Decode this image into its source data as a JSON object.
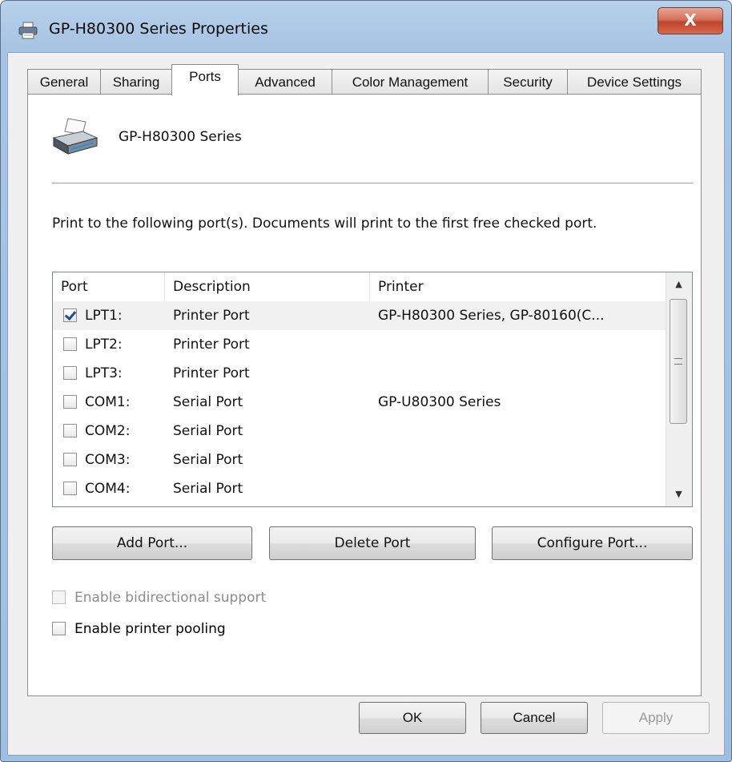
{
  "window": {
    "title": "GP-H80300 Series Properties",
    "close_label": "X"
  },
  "tabs": [
    {
      "label": "General"
    },
    {
      "label": "Sharing"
    },
    {
      "label": "Ports"
    },
    {
      "label": "Advanced"
    },
    {
      "label": "Color Management"
    },
    {
      "label": "Security"
    },
    {
      "label": "Device Settings"
    }
  ],
  "active_tab": "Ports",
  "printer": {
    "name": "GP-H80300 Series"
  },
  "instructions": "Print to the following port(s). Documents will print to the first free checked port.",
  "port_list": {
    "columns": [
      "Port",
      "Description",
      "Printer"
    ],
    "rows": [
      {
        "port": "LPT1:",
        "description": "Printer Port",
        "printer": "GP-H80300 Series, GP-80160(C...",
        "checked": true
      },
      {
        "port": "LPT2:",
        "description": "Printer Port",
        "printer": "",
        "checked": false
      },
      {
        "port": "LPT3:",
        "description": "Printer Port",
        "printer": "",
        "checked": false
      },
      {
        "port": "COM1:",
        "description": "Serial Port",
        "printer": "GP-U80300 Series",
        "checked": false
      },
      {
        "port": "COM2:",
        "description": "Serial Port",
        "printer": "",
        "checked": false
      },
      {
        "port": "COM3:",
        "description": "Serial Port",
        "printer": "",
        "checked": false
      },
      {
        "port": "COM4:",
        "description": "Serial Port",
        "printer": "",
        "checked": false
      }
    ]
  },
  "port_buttons": {
    "add": "Add Port...",
    "delete": "Delete Port",
    "configure": "Configure Port..."
  },
  "options": {
    "bidirectional": {
      "label": "Enable bidirectional support",
      "checked": false,
      "enabled": false
    },
    "pooling": {
      "label": "Enable printer pooling",
      "checked": false,
      "enabled": true
    }
  },
  "dialog_buttons": {
    "ok": "OK",
    "cancel": "Cancel",
    "apply": "Apply"
  }
}
